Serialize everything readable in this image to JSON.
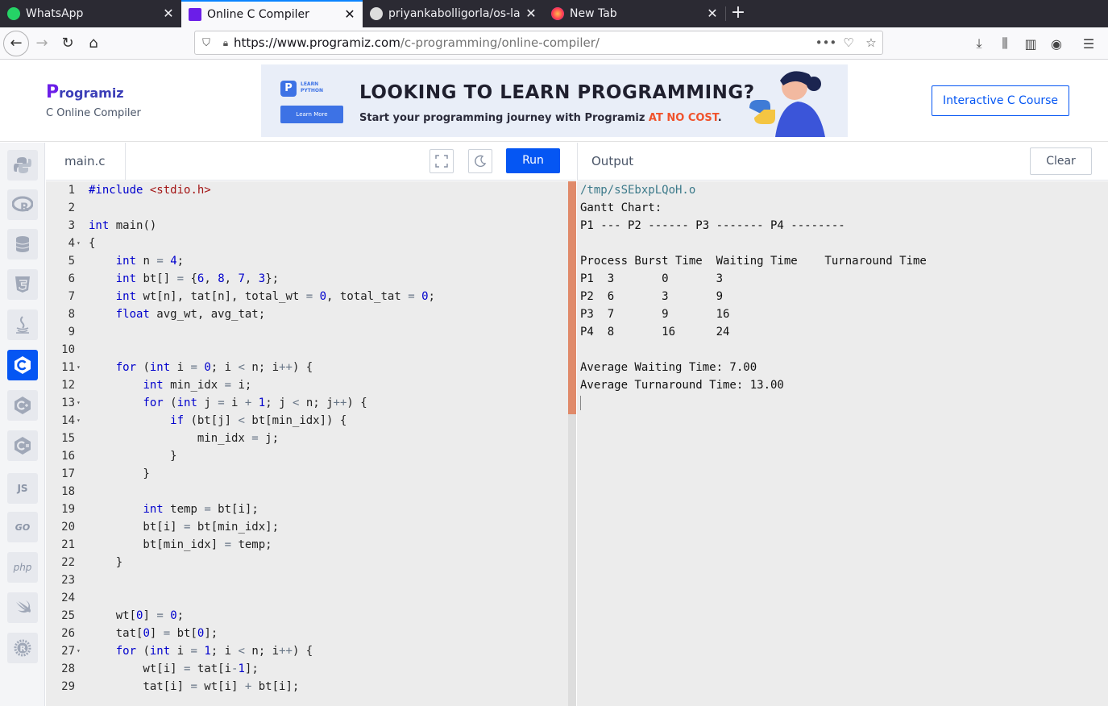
{
  "browser": {
    "tabs": [
      {
        "title": "WhatsApp",
        "active": false
      },
      {
        "title": "Online C Compiler",
        "active": true
      },
      {
        "title": "priyankabolligorla/os-la",
        "active": false
      },
      {
        "title": "New Tab",
        "active": false
      }
    ],
    "url_host": "https://www.programiz.com",
    "url_path": "/c-programming/online-compiler/"
  },
  "header": {
    "logo_text": "rogramiz",
    "logo_letter": "P",
    "subtitle": "C Online Compiler",
    "banner_card_line1": "LEARN",
    "banner_card_line2": "PYTHON",
    "banner_learn_more": "Learn More",
    "banner_headline": "LOOKING TO LEARN PROGRAMMING?",
    "banner_sub_prefix": "Start your programming journey with Programiz ",
    "banner_sub_highlight": "AT NO COST",
    "banner_sub_suffix": ".",
    "course_button": "Interactive C Course"
  },
  "rail": {
    "items": [
      "python",
      "r",
      "sql",
      "html5",
      "java",
      "c",
      "cpp",
      "csharp",
      "js",
      "go",
      "php",
      "swift",
      "rust"
    ],
    "labels": {
      "js": "JS",
      "go": "GO",
      "php": "php"
    }
  },
  "editor": {
    "file_name": "main.c",
    "run_label": "Run",
    "lines": [
      {
        "n": "1",
        "fold": "",
        "html": "<span class='kw'>#include</span> <span class='str'>&lt;stdio.h&gt;</span>"
      },
      {
        "n": "2",
        "fold": "",
        "html": ""
      },
      {
        "n": "3",
        "fold": "",
        "html": "<span class='kw'>int</span> main()"
      },
      {
        "n": "4",
        "fold": "▾",
        "html": "{"
      },
      {
        "n": "5",
        "fold": "",
        "html": "    <span class='kw'>int</span> n <span class='op'>=</span> <span class='num'>4</span>;"
      },
      {
        "n": "6",
        "fold": "",
        "html": "    <span class='kw'>int</span> bt[] <span class='op'>=</span> {<span class='num'>6</span>, <span class='num'>8</span>, <span class='num'>7</span>, <span class='num'>3</span>};"
      },
      {
        "n": "7",
        "fold": "",
        "html": "    <span class='kw'>int</span> wt[n], tat[n], total_wt <span class='op'>=</span> <span class='num'>0</span>, total_tat <span class='op'>=</span> <span class='num'>0</span>;"
      },
      {
        "n": "8",
        "fold": "",
        "html": "    <span class='kw'>float</span> avg_wt, avg_tat;"
      },
      {
        "n": "9",
        "fold": "",
        "html": ""
      },
      {
        "n": "10",
        "fold": "",
        "html": ""
      },
      {
        "n": "11",
        "fold": "▾",
        "html": "    <span class='kw'>for</span> (<span class='kw'>int</span> i <span class='op'>=</span> <span class='num'>0</span>; i <span class='op'>&lt;</span> n; i<span class='op'>++</span>) {"
      },
      {
        "n": "12",
        "fold": "",
        "html": "        <span class='kw'>int</span> min_idx <span class='op'>=</span> i;"
      },
      {
        "n": "13",
        "fold": "▾",
        "html": "        <span class='kw'>for</span> (<span class='kw'>int</span> j <span class='op'>=</span> i <span class='op'>+</span> <span class='num'>1</span>; j <span class='op'>&lt;</span> n; j<span class='op'>++</span>) {"
      },
      {
        "n": "14",
        "fold": "▾",
        "html": "            <span class='kw'>if</span> (bt[j] <span class='op'>&lt;</span> bt[min_idx]) {"
      },
      {
        "n": "15",
        "fold": "",
        "html": "                min_idx <span class='op'>=</span> j;"
      },
      {
        "n": "16",
        "fold": "",
        "html": "            }"
      },
      {
        "n": "17",
        "fold": "",
        "html": "        }"
      },
      {
        "n": "18",
        "fold": "",
        "html": ""
      },
      {
        "n": "19",
        "fold": "",
        "html": "        <span class='kw'>int</span> temp <span class='op'>=</span> bt[i];"
      },
      {
        "n": "20",
        "fold": "",
        "html": "        bt[i] <span class='op'>=</span> bt[min_idx];"
      },
      {
        "n": "21",
        "fold": "",
        "html": "        bt[min_idx] <span class='op'>=</span> temp;"
      },
      {
        "n": "22",
        "fold": "",
        "html": "    }"
      },
      {
        "n": "23",
        "fold": "",
        "html": ""
      },
      {
        "n": "24",
        "fold": "",
        "html": ""
      },
      {
        "n": "25",
        "fold": "",
        "html": "    wt[<span class='num'>0</span>] <span class='op'>=</span> <span class='num'>0</span>;"
      },
      {
        "n": "26",
        "fold": "",
        "html": "    tat[<span class='num'>0</span>] <span class='op'>=</span> bt[<span class='num'>0</span>];"
      },
      {
        "n": "27",
        "fold": "▾",
        "html": "    <span class='kw'>for</span> (<span class='kw'>int</span> i <span class='op'>=</span> <span class='num'>1</span>; i <span class='op'>&lt;</span> n; i<span class='op'>++</span>) {"
      },
      {
        "n": "28",
        "fold": "",
        "html": "        wt[i] <span class='op'>=</span> tat[i<span class='op'>-</span><span class='num'>1</span>];"
      },
      {
        "n": "29",
        "fold": "",
        "html": "        tat[i] <span class='op'>=</span> wt[i] <span class='op'>+</span> bt[i];"
      }
    ]
  },
  "output": {
    "title": "Output",
    "clear_label": "Clear",
    "lines": [
      "/tmp/sSEbxpLQoH.o",
      "Gantt Chart:",
      "P1 --- P2 ------ P3 ------- P4 --------",
      "",
      "Process Burst Time  Waiting Time    Turnaround Time",
      "P1  3       0       3",
      "P2  6       3       9",
      "P3  7       9       16",
      "P4  8       16      24",
      "",
      "Average Waiting Time: 7.00",
      "Average Turnaround Time: 13.00"
    ]
  }
}
